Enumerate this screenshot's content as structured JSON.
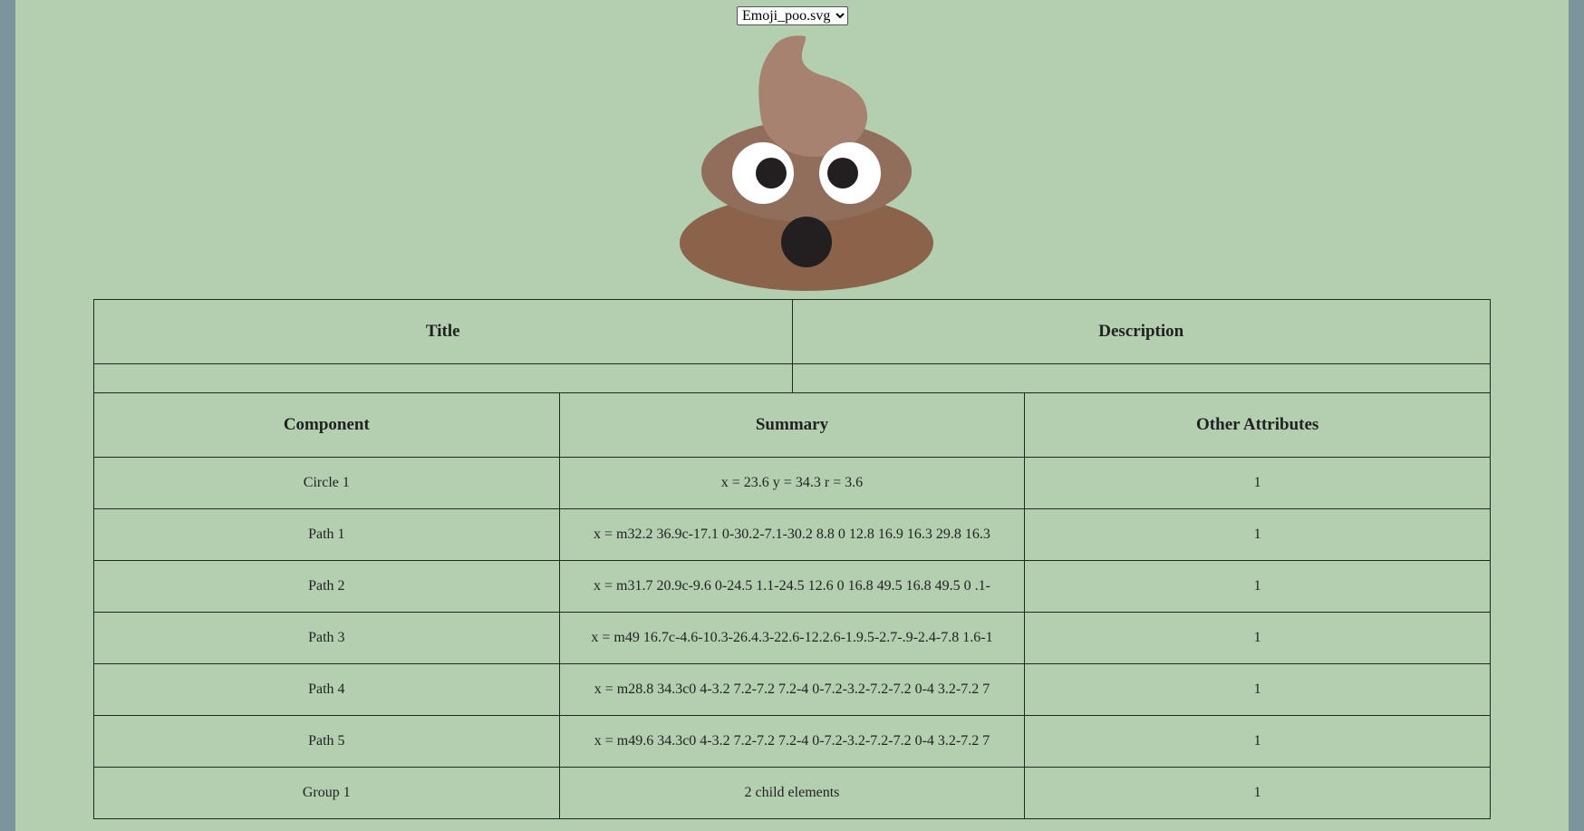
{
  "file_select": {
    "selected": "Emoji_poo.svg",
    "options": [
      "Emoji_poo.svg"
    ]
  },
  "emoji": {
    "icon": "poo-emoji-icon",
    "colors": {
      "base": "#8a634a",
      "middle": "#906e5b",
      "top": "#a88270",
      "eye_white": "#ffffff",
      "pupil": "#231f20",
      "mouth": "#231f20"
    }
  },
  "meta_table": {
    "headers": [
      "Title",
      "Description"
    ],
    "values": [
      "",
      ""
    ]
  },
  "component_table": {
    "headers": [
      "Component",
      "Summary",
      "Other Attributes"
    ],
    "rows": [
      [
        "Circle 1",
        "x = 23.6 y = 34.3 r = 3.6",
        "1"
      ],
      [
        "Path 1",
        "x = m32.2 36.9c-17.1 0-30.2-7.1-30.2 8.8 0 12.8 16.9 16.3 29.8 16.3",
        "1"
      ],
      [
        "Path 2",
        "x = m31.7 20.9c-9.6 0-24.5 1.1-24.5 12.6 0 16.8 49.5 16.8 49.5 0 .1-",
        "1"
      ],
      [
        "Path 3",
        "x = m49 16.7c-4.6-10.3-26.4.3-22.6-12.2.6-1.9.5-2.7-.9-2.4-7.8 1.6-1",
        "1"
      ],
      [
        "Path 4",
        "x = m28.8 34.3c0 4-3.2 7.2-7.2 7.2-4 0-7.2-3.2-7.2-7.2 0-4 3.2-7.2 7",
        "1"
      ],
      [
        "Path 5",
        "x = m49.6 34.3c0 4-3.2 7.2-7.2 7.2-4 0-7.2-3.2-7.2-7.2 0-4 3.2-7.2 7",
        "1"
      ],
      [
        "Group 1",
        "2 child elements",
        "1"
      ]
    ]
  },
  "colors": {
    "page_background": "#b3cfb0",
    "side_background": "#7a959b",
    "table_border": "#1e2a20"
  }
}
